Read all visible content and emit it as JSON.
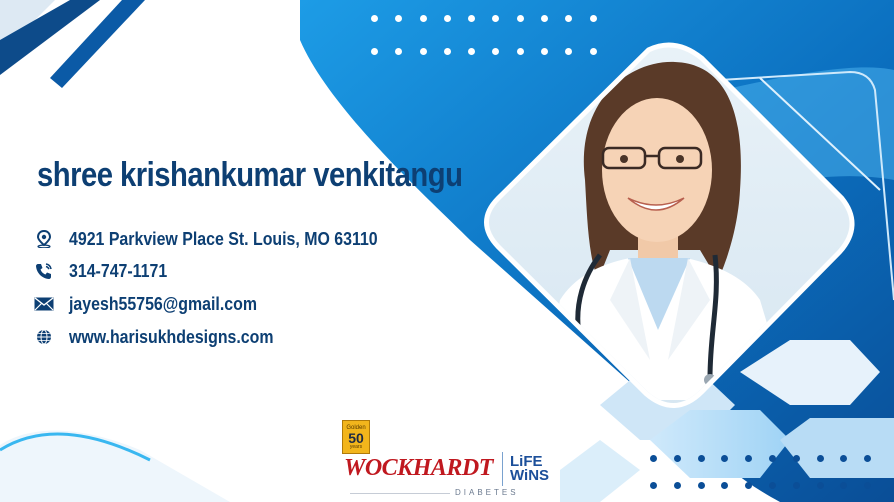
{
  "card": {
    "name": "shree krishankumar venkitangu",
    "address": "4921 Parkview Place St. Louis, MO 63110",
    "phone": "314-747-1171",
    "email": "jayesh55756@gmail.com",
    "website": "www.harisukhdesigns.com"
  },
  "icons": {
    "address": "location-pin-icon",
    "phone": "phone-icon",
    "email": "envelope-icon",
    "website": "globe-icon"
  },
  "logo": {
    "badge_top": "Golden",
    "badge_number": "50",
    "badge_bottom": "years",
    "brand": "WOCKHARDT",
    "tagline_line1": "LiFE",
    "tagline_line2": "WiNS",
    "sub": "DIABETES"
  },
  "colors": {
    "primary_text": "#0d3f73",
    "accent_blue": "#0b6fbf",
    "light_blue": "#39b7f0",
    "brand_red": "#c0181f"
  }
}
